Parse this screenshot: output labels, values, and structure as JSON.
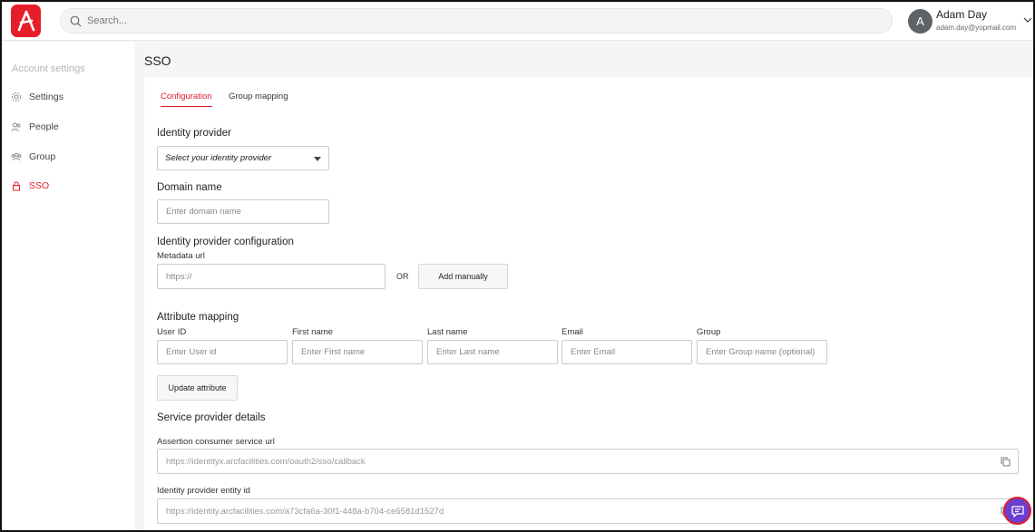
{
  "header": {
    "search_placeholder": "Search...",
    "user": {
      "initial": "A",
      "name": "Adam Day",
      "email": "adam.day@yopmail.com"
    }
  },
  "sidebar": {
    "title": "Account settings",
    "items": [
      {
        "label": "Settings",
        "icon": "gear-icon"
      },
      {
        "label": "People",
        "icon": "people-icon"
      },
      {
        "label": "Group",
        "icon": "group-icon"
      },
      {
        "label": "SSO",
        "icon": "lock-icon",
        "active": true
      }
    ]
  },
  "page": {
    "title": "SSO",
    "tabs": [
      {
        "label": "Configuration",
        "active": true
      },
      {
        "label": "Group mapping",
        "active": false
      }
    ]
  },
  "form": {
    "identity_provider": {
      "label": "Identity provider",
      "selected": "Select your identity provider"
    },
    "domain": {
      "label": "Domain name",
      "placeholder": "Enter domain name"
    },
    "idp_config": {
      "label": "Identity provider configuration",
      "metadata_label": "Metadata url",
      "metadata_placeholder": "https://",
      "or_text": "OR",
      "add_manually_label": "Add manually"
    },
    "attribute_mapping": {
      "label": "Attribute mapping",
      "fields": [
        {
          "label": "User ID",
          "placeholder": "Enter User id"
        },
        {
          "label": "First name",
          "placeholder": "Enter First name"
        },
        {
          "label": "Last name",
          "placeholder": "Enter Last name"
        },
        {
          "label": "Email",
          "placeholder": "Enter Email"
        },
        {
          "label": "Group",
          "placeholder": "Enter Group name (optional)"
        }
      ],
      "update_label": "Update attribute"
    },
    "service_provider": {
      "label": "Service provider details",
      "acs_label": "Assertion consumer service url",
      "acs_value": "https://identityx.arcfacilities.com/oauth2/sso/callback",
      "entity_label": "Identity provider entity id",
      "entity_value": "https://identity.arcfacilities.com/a73cfa6a-30f1-448a-b704-ce6581d1527d"
    }
  },
  "colors": {
    "accent": "#e11d2a",
    "logo": "#e61e2b",
    "chat": "#6a3fd1"
  }
}
